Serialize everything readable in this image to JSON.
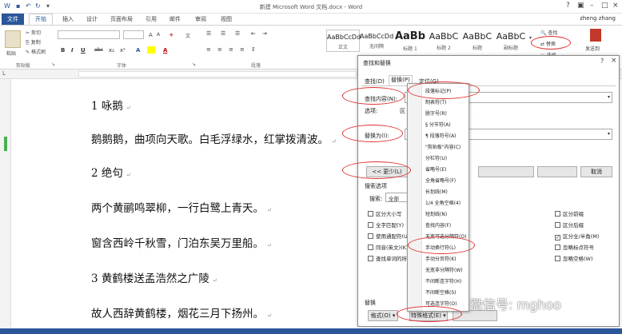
{
  "window": {
    "title": "新建 Microsoft Word 文档.docx - Word",
    "user": "zheng zhang"
  },
  "tabs": [
    "文件",
    "开始",
    "插入",
    "设计",
    "页面布局",
    "引用",
    "邮件",
    "审阅",
    "视图"
  ],
  "ribbon": {
    "paste_label": "粘贴",
    "cut": "剪切",
    "copy": "复制",
    "format_painter": "格式刷",
    "clipboard_group": "剪贴板",
    "font_group": "字体",
    "paragraph_group": "段落",
    "styles": [
      {
        "preview": "AaBbCcDd",
        "name": "正文"
      },
      {
        "preview": "AaBbCcDd",
        "name": "无间隔"
      },
      {
        "preview": "AaBb",
        "name": "标题 1"
      },
      {
        "preview": "AaBbC",
        "name": "标题 2"
      },
      {
        "preview": "AaBbC",
        "name": "标题"
      },
      {
        "preview": "AaBbC",
        "name": "副标题"
      }
    ],
    "find": "查找",
    "replace": "替换",
    "select": "选择",
    "send_to": "发送到",
    "format_buttons": [
      "B",
      "I",
      "U",
      "abc",
      "x₂",
      "x²",
      "A",
      "A"
    ]
  },
  "document": {
    "lines": [
      "1 咏鹅",
      "鹅鹅鹅，曲项向天歌。白毛浮绿水，红掌拨清波。",
      "2 绝句",
      "两个黄鹂鸣翠柳，一行白鹭上青天。",
      "窗含西岭千秋雪，门泊东吴万里船。",
      "3 黄鹤楼送孟浩然之广陵",
      "故人西辞黄鹤楼，烟花三月下扬州。"
    ]
  },
  "dialog": {
    "title": "查找和替换",
    "help": "?",
    "close": "×",
    "tabs": [
      "查找(D)",
      "替换(P)",
      "定位(G)"
    ],
    "find_label": "查找内容(N):",
    "options_label": "选项:",
    "options_value": "区",
    "replace_label": "替换为(I):",
    "less_button": "<< 更少(L)",
    "cancel_button": "取消",
    "search_options": "搜索选项",
    "search_label": "搜索:",
    "search_value": "全部",
    "left_checks": [
      "区分大小写",
      "全字匹配(Y)",
      "使用通配符(U)",
      "同音(英文)(K)",
      "查找单词的所有"
    ],
    "right_checks": [
      "区分前缀",
      "区分后缀",
      "区分全/半角(M)",
      "忽略标点符号",
      "忽略空格(W)"
    ],
    "right_checked": [
      false,
      false,
      true,
      false,
      false
    ],
    "replace_section": "替换",
    "format_button": "格式(O)",
    "special_button": "特殊格式(E)"
  },
  "special_menu": [
    "段落标记(P)",
    "制表符(T)",
    "脱字号(R)",
    "§ 分节符(A)",
    "¶ 段落符号(A)",
    "\"剪贴板\"内容(C)",
    "分栏符(U)",
    "省略号(E)",
    "全角省略号(F)",
    "长划线(M)",
    "1/4 全角空格(4)",
    "短划线(N)",
    "查找内容(F)",
    "无宽可选分隔符(O)",
    "手动换行符(L)",
    "手动分页符(K)",
    "无宽非分隔符(W)",
    "不间断连字符(H)",
    "不间断空格(S)",
    "可选连字符(O)"
  ],
  "watermark": "微信号: mghoo"
}
